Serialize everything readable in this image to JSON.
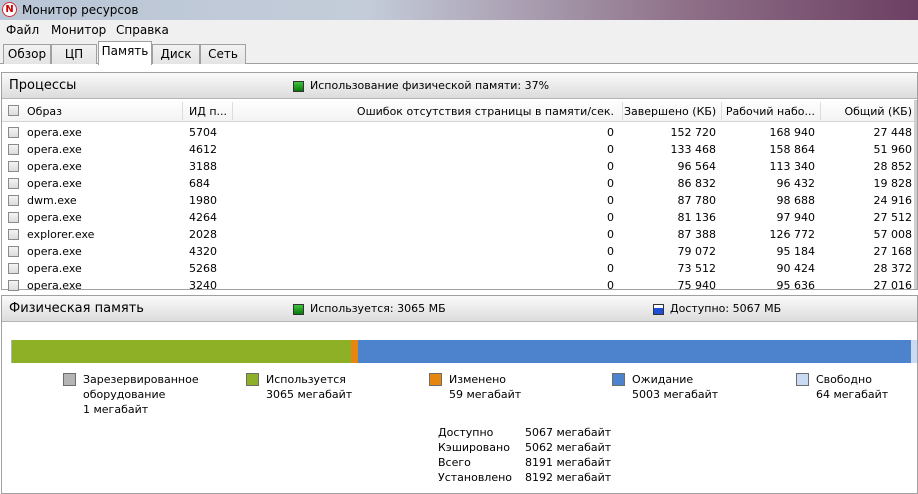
{
  "window": {
    "title": "Монитор ресурсов",
    "app_icon_glyph": "N"
  },
  "menu": [
    "Файл",
    "Монитор",
    "Справка"
  ],
  "tabs": [
    {
      "label": "Обзор",
      "active": false
    },
    {
      "label": "ЦП",
      "active": false
    },
    {
      "label": "Память",
      "active": true
    },
    {
      "label": "Диск",
      "active": false
    },
    {
      "label": "Сеть",
      "active": false
    }
  ],
  "processes": {
    "title": "Процессы",
    "usage_text": "Использование физической памяти: 37%",
    "columns": [
      "Образ",
      "ИД п...",
      "Ошибок отсутствия страницы в памяти/сек.",
      "Завершено (КБ)",
      "Рабочий набо...",
      "Общий (КБ)"
    ],
    "rows": [
      [
        "opera.exe",
        "5704",
        "0",
        "152 720",
        "168 940",
        "27 448"
      ],
      [
        "opera.exe",
        "4612",
        "0",
        "133 468",
        "158 864",
        "51 960"
      ],
      [
        "opera.exe",
        "3188",
        "0",
        "96 564",
        "113 340",
        "28 852"
      ],
      [
        "opera.exe",
        "684",
        "0",
        "86 832",
        "96 432",
        "19 828"
      ],
      [
        "dwm.exe",
        "1980",
        "0",
        "87 780",
        "98 688",
        "24 916"
      ],
      [
        "opera.exe",
        "4264",
        "0",
        "81 136",
        "97 940",
        "27 512"
      ],
      [
        "explorer.exe",
        "2028",
        "0",
        "87 388",
        "126 772",
        "57 008"
      ],
      [
        "opera.exe",
        "4320",
        "0",
        "79 072",
        "95 184",
        "27 168"
      ],
      [
        "opera.exe",
        "5268",
        "0",
        "73 512",
        "90 424",
        "28 372"
      ],
      [
        "opera.exe",
        "3240",
        "0",
        "75 940",
        "95 636",
        "27 016"
      ]
    ]
  },
  "physical": {
    "title": "Физическая память",
    "used_text": "Используется: 3065 МБ",
    "available_text": "Доступно: 5067 МБ",
    "colors": {
      "reserved": "#b4b4b4",
      "used": "#8db026",
      "modified": "#e5860f",
      "standby": "#4d83cd",
      "free": "#c9daf2"
    },
    "bar_mb": {
      "reserved": 1,
      "used": 3065,
      "modified": 59,
      "standby": 5003,
      "free": 64
    },
    "legend": [
      {
        "lines": [
          "Зарезервированное",
          "оборудование",
          "1 мегабайт"
        ]
      },
      {
        "lines": [
          "Используется",
          "3065 мегабайт"
        ]
      },
      {
        "lines": [
          "Изменено",
          "59 мегабайт"
        ]
      },
      {
        "lines": [
          "Ожидание",
          "5003 мегабайт"
        ]
      },
      {
        "lines": [
          "Свободно",
          "64 мегабайт"
        ]
      }
    ],
    "summary": [
      {
        "label": "Доступно",
        "value": "5067 мегабайт"
      },
      {
        "label": "Кэшировано",
        "value": "5062 мегабайт"
      },
      {
        "label": "Всего",
        "value": "8191 мегабайт"
      },
      {
        "label": "Установлено",
        "value": "8192 мегабайт"
      }
    ]
  }
}
